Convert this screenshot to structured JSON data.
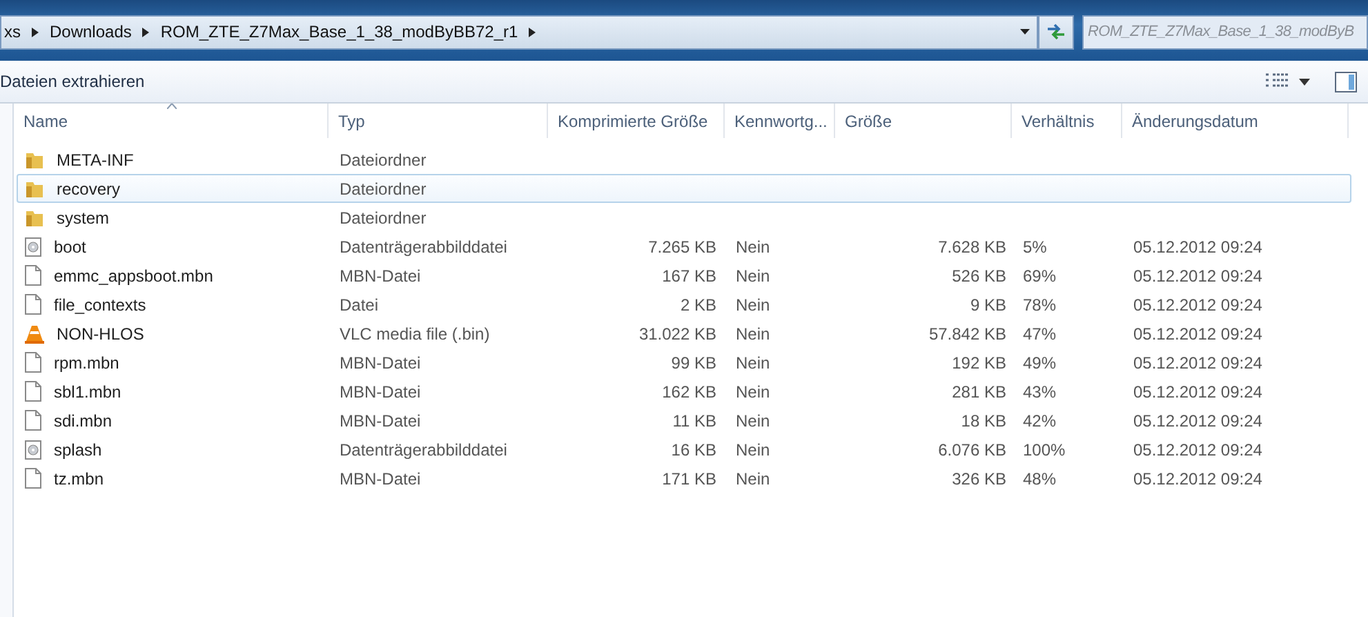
{
  "address_bar": {
    "crumbs": [
      "xs",
      "Downloads",
      "ROM_ZTE_Z7Max_Base_1_38_modByBB72_r1"
    ]
  },
  "search": {
    "placeholder": "ROM_ZTE_Z7Max_Base_1_38_modByB"
  },
  "toolbar": {
    "buttons": [
      "Dateien extrahieren"
    ]
  },
  "table": {
    "columns": [
      "Name",
      "Typ",
      "Komprimierte Größe",
      "Kennwortg...",
      "Größe",
      "Verhältnis",
      "Änderungsdatum"
    ],
    "rows": [
      {
        "kind": "folder",
        "name": "META-INF",
        "type": "Dateiordner",
        "selected": false
      },
      {
        "kind": "folder",
        "name": "recovery",
        "type": "Dateiordner",
        "selected": true
      },
      {
        "kind": "folder",
        "name": "system",
        "type": "Dateiordner",
        "selected": false
      },
      {
        "kind": "disc",
        "name": "boot",
        "type": "Datenträgerabbilddatei",
        "compressed": "7.265 KB",
        "password": "Nein",
        "size": "7.628 KB",
        "ratio": "5%",
        "date": "05.12.2012 09:24",
        "selected": false
      },
      {
        "kind": "file",
        "name": "emmc_appsboot.mbn",
        "type": "MBN-Datei",
        "compressed": "167 KB",
        "password": "Nein",
        "size": "526 KB",
        "ratio": "69%",
        "date": "05.12.2012 09:24",
        "selected": false
      },
      {
        "kind": "file",
        "name": "file_contexts",
        "type": "Datei",
        "compressed": "2 KB",
        "password": "Nein",
        "size": "9 KB",
        "ratio": "78%",
        "date": "05.12.2012 09:24",
        "selected": false
      },
      {
        "kind": "vlc",
        "name": "NON-HLOS",
        "type": "VLC media file (.bin)",
        "compressed": "31.022 KB",
        "password": "Nein",
        "size": "57.842 KB",
        "ratio": "47%",
        "date": "05.12.2012 09:24",
        "selected": false
      },
      {
        "kind": "file",
        "name": "rpm.mbn",
        "type": "MBN-Datei",
        "compressed": "99 KB",
        "password": "Nein",
        "size": "192 KB",
        "ratio": "49%",
        "date": "05.12.2012 09:24",
        "selected": false
      },
      {
        "kind": "file",
        "name": "sbl1.mbn",
        "type": "MBN-Datei",
        "compressed": "162 KB",
        "password": "Nein",
        "size": "281 KB",
        "ratio": "43%",
        "date": "05.12.2012 09:24",
        "selected": false
      },
      {
        "kind": "file",
        "name": "sdi.mbn",
        "type": "MBN-Datei",
        "compressed": "11 KB",
        "password": "Nein",
        "size": "18 KB",
        "ratio": "42%",
        "date": "05.12.2012 09:24",
        "selected": false
      },
      {
        "kind": "disc",
        "name": "splash",
        "type": "Datenträgerabbilddatei",
        "compressed": "16 KB",
        "password": "Nein",
        "size": "6.076 KB",
        "ratio": "100%",
        "date": "05.12.2012 09:24",
        "selected": false
      },
      {
        "kind": "file",
        "name": "tz.mbn",
        "type": "MBN-Datei",
        "compressed": "171 KB",
        "password": "Nein",
        "size": "326 KB",
        "ratio": "48%",
        "date": "05.12.2012 09:24",
        "selected": false
      }
    ]
  }
}
